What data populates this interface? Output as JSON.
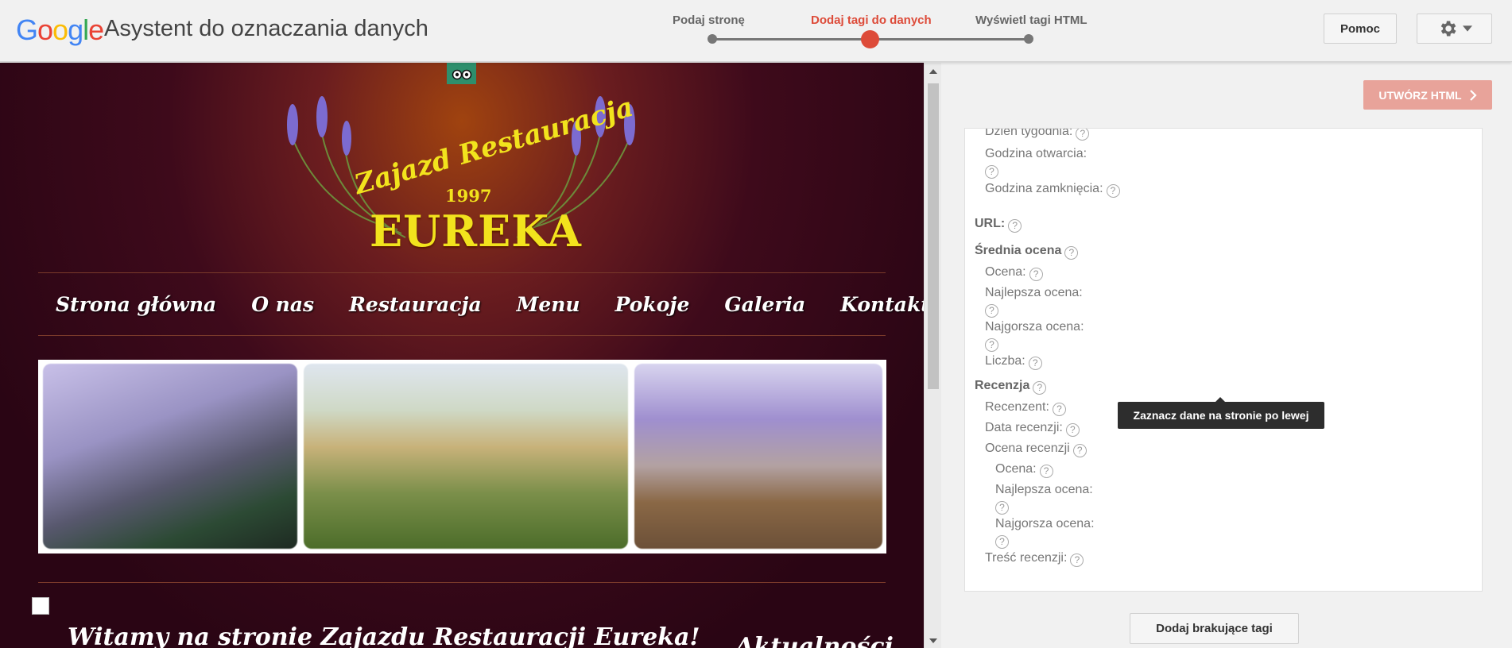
{
  "header": {
    "logo_letters": [
      {
        "ch": "G",
        "color": "#4285F4"
      },
      {
        "ch": "o",
        "color": "#EA4335"
      },
      {
        "ch": "o",
        "color": "#FBBC05"
      },
      {
        "ch": "g",
        "color": "#4285F4"
      },
      {
        "ch": "l",
        "color": "#34A853"
      },
      {
        "ch": "e",
        "color": "#EA4335"
      }
    ],
    "app_title": "Asystent do oznaczania danych",
    "steps": [
      {
        "label": "Podaj stronę",
        "active": false
      },
      {
        "label": "Dodaj tagi do danych",
        "active": true
      },
      {
        "label": "Wyświetl tagi HTML",
        "active": false
      }
    ],
    "help_label": "Pomoc",
    "settings_icon": "gear-icon"
  },
  "website": {
    "logo_top": "Zajazd Restauracja",
    "logo_year": "1997",
    "logo_name": "EUREKA",
    "nav": [
      "Strona główna",
      "O nas",
      "Restauracja",
      "Menu",
      "Pokoje",
      "Galeria",
      "Kontakt"
    ],
    "welcome": "Witamy na stronie Zajazdu Restauracji Eureka!",
    "news": "Aktualności"
  },
  "panel": {
    "create_html_label": "UTWÓRZ HTML",
    "tooltip": "Zaznacz dane na stronie po lewej",
    "add_missing_label": "Dodaj brakujące tagi",
    "tags": [
      {
        "label": "Dzień tygodnia:",
        "level": 1,
        "head": false
      },
      {
        "label": "Godzina otwarcia:",
        "level": 1,
        "head": false
      },
      {
        "label": "Godzina zamknięcia:",
        "level": 1,
        "head": false
      },
      {
        "label": "URL:",
        "level": 0,
        "head": true
      },
      {
        "label": "Średnia ocena",
        "level": 0,
        "head": true
      },
      {
        "label": "Ocena:",
        "level": 1,
        "head": false
      },
      {
        "label": "Najlepsza ocena:",
        "level": 1,
        "head": false
      },
      {
        "label": "Najgorsza ocena:",
        "level": 1,
        "head": false
      },
      {
        "label": "Liczba:",
        "level": 1,
        "head": false
      },
      {
        "label": "Recenzja",
        "level": 0,
        "head": true
      },
      {
        "label": "Recenzent:",
        "level": 1,
        "head": false
      },
      {
        "label": "Data recenzji:",
        "level": 1,
        "head": false
      },
      {
        "label": "Ocena recenzji",
        "level": 1,
        "head": false
      },
      {
        "label": "Ocena:",
        "level": 2,
        "head": false
      },
      {
        "label": "Najlepsza ocena:",
        "level": 2,
        "head": false
      },
      {
        "label": "Najgorsza ocena:",
        "level": 2,
        "head": false
      },
      {
        "label": "Treść recenzji:",
        "level": 1,
        "head": false
      }
    ]
  }
}
